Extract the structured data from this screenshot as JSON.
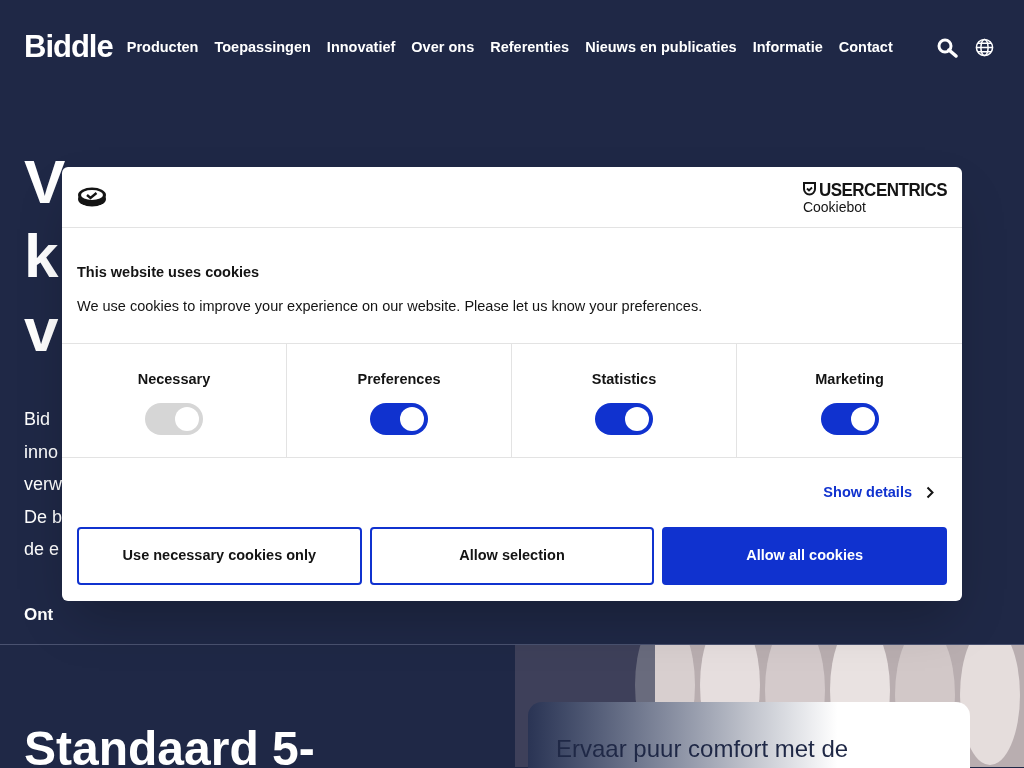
{
  "header": {
    "logo": "Biddle",
    "nav": [
      "Producten",
      "Toepassingen",
      "Innovatief",
      "Over ons",
      "Referenties",
      "Nieuws en publicaties",
      "Informatie",
      "Contact"
    ]
  },
  "hero": {
    "heading_lines": [
      "V",
      "k",
      "v"
    ],
    "text_lines": [
      "Bid",
      "inno",
      "verw",
      "De b",
      "de e"
    ],
    "link": "Ont"
  },
  "section": {
    "heading": "Standaard 5-",
    "card_text": "Ervaar puur comfort met de"
  },
  "cookie_dialog": {
    "brand": "USERCENTRICS",
    "brand_sub": "Cookiebot",
    "title": "This website uses cookies",
    "text": "We use cookies to improve your experience on our website. Please let us know your preferences.",
    "categories": [
      {
        "label": "Necessary",
        "checked": true,
        "disabled": true
      },
      {
        "label": "Preferences",
        "checked": true,
        "disabled": false
      },
      {
        "label": "Statistics",
        "checked": true,
        "disabled": false
      },
      {
        "label": "Marketing",
        "checked": true,
        "disabled": false
      }
    ],
    "details_link": "Show details",
    "buttons": [
      {
        "label": "Use necessary cookies only",
        "kind": "outline"
      },
      {
        "label": "Allow selection",
        "kind": "outline"
      },
      {
        "label": "Allow all cookies",
        "kind": "primary"
      }
    ]
  }
}
